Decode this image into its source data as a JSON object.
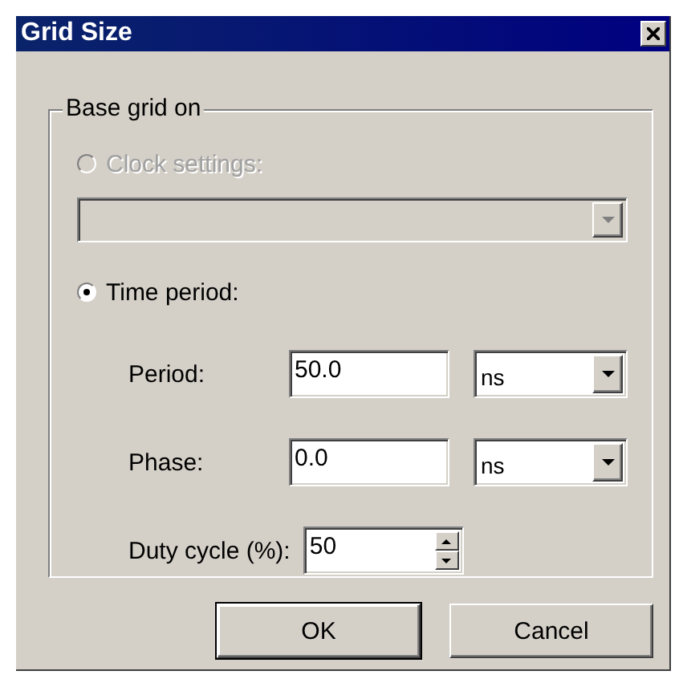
{
  "window": {
    "title": "Grid Size"
  },
  "group": {
    "title": "Base grid on"
  },
  "options": [
    {
      "kind": "clock",
      "label": "Clock settings:",
      "selected": false,
      "disabled": true
    },
    {
      "kind": "time",
      "label": "Time period:",
      "selected": true,
      "disabled": false
    }
  ],
  "clock_combo": {
    "disabled": true
  },
  "fields": [
    {
      "label": "Period:",
      "value": "50.0",
      "unit": "ns"
    },
    {
      "label": "Phase:",
      "value": "0.0",
      "unit": "ns"
    }
  ],
  "duty": {
    "label": "Duty cycle (%):",
    "value": "50"
  },
  "buttons": [
    {
      "label": "OK",
      "default": true
    },
    {
      "label": "Cancel",
      "default": false
    }
  ]
}
